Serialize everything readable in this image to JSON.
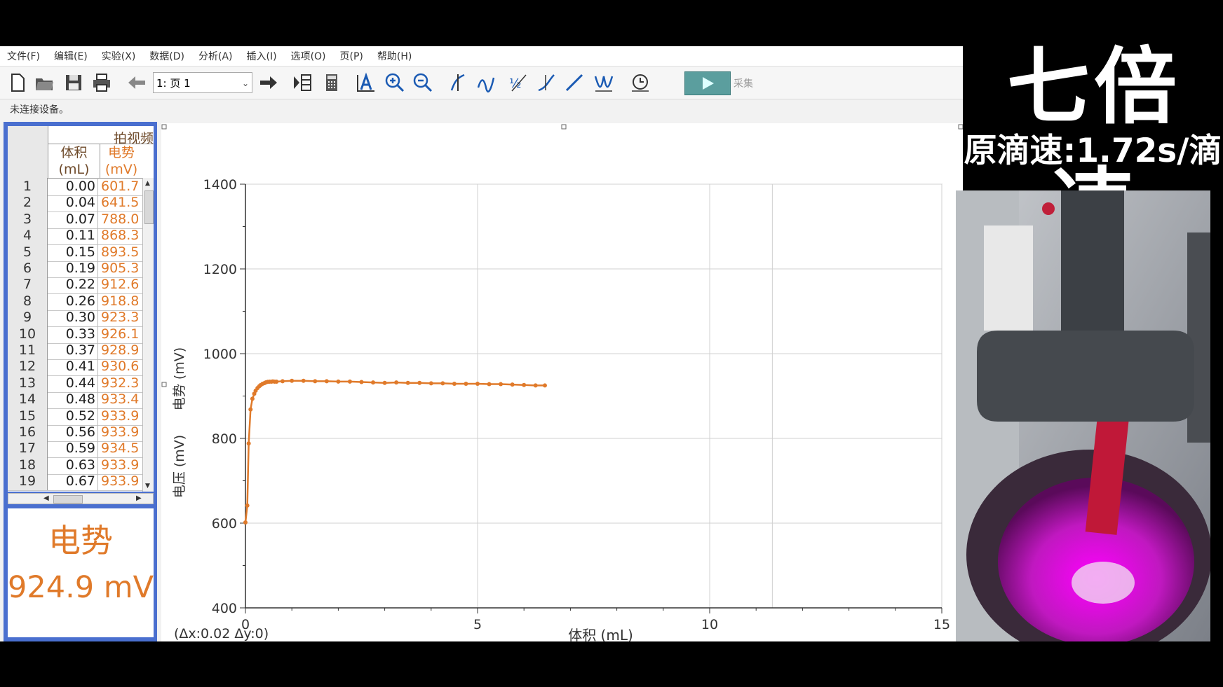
{
  "overlay": {
    "title": "七倍速",
    "subtitle": "原滴速:1.72s/滴"
  },
  "menubar": [
    "文件(F)",
    "编辑(E)",
    "实验(X)",
    "数据(D)",
    "分析(A)",
    "插入(I)",
    "选项(O)",
    "页(P)",
    "帮助(H)"
  ],
  "toolbar": {
    "page_select": "1: 页 1",
    "collect_label": "采集"
  },
  "status": "未连接设备。",
  "table": {
    "title": "拍视频",
    "col_volume": [
      "体积",
      "(mL)"
    ],
    "col_emf": [
      "电势",
      "(mV)"
    ],
    "rows": [
      [
        "1",
        "0.00",
        "601.7"
      ],
      [
        "2",
        "0.04",
        "641.5"
      ],
      [
        "3",
        "0.07",
        "788.0"
      ],
      [
        "4",
        "0.11",
        "868.3"
      ],
      [
        "5",
        "0.15",
        "893.5"
      ],
      [
        "6",
        "0.19",
        "905.3"
      ],
      [
        "7",
        "0.22",
        "912.6"
      ],
      [
        "8",
        "0.26",
        "918.8"
      ],
      [
        "9",
        "0.30",
        "923.3"
      ],
      [
        "10",
        "0.33",
        "926.1"
      ],
      [
        "11",
        "0.37",
        "928.9"
      ],
      [
        "12",
        "0.41",
        "930.6"
      ],
      [
        "13",
        "0.44",
        "932.3"
      ],
      [
        "14",
        "0.48",
        "933.4"
      ],
      [
        "15",
        "0.52",
        "933.9"
      ],
      [
        "16",
        "0.56",
        "933.9"
      ],
      [
        "17",
        "0.59",
        "934.5"
      ],
      [
        "18",
        "0.63",
        "933.9"
      ],
      [
        "19",
        "0.67",
        "933.9"
      ]
    ]
  },
  "meter": {
    "label": "电势",
    "value": "924.9 mV"
  },
  "graph": {
    "delta_readout": "(Δx:0.02 Δy:0)",
    "xlabel": "体积 (mL)",
    "ylabel_primary": "电势 (mV)",
    "ylabel_secondary": "电压 (mV)"
  },
  "colors": {
    "series": "#e07a2a",
    "table_panel": "#4a6fcf",
    "collect_button": "#5b9e9e"
  },
  "chart_data": {
    "type": "scatter",
    "xlabel": "体积 (mL)",
    "ylabel": "电势 (mV)",
    "xlim": [
      0,
      15
    ],
    "ylim": [
      400,
      1400
    ],
    "xticks": [
      0,
      5,
      10,
      15
    ],
    "yticks": [
      400,
      600,
      800,
      1000,
      1200,
      1400
    ],
    "grid": true,
    "series": [
      {
        "name": "电势",
        "x": [
          0.0,
          0.04,
          0.07,
          0.11,
          0.15,
          0.19,
          0.22,
          0.26,
          0.3,
          0.33,
          0.37,
          0.41,
          0.44,
          0.48,
          0.52,
          0.56,
          0.59,
          0.63,
          0.67,
          0.8,
          1.0,
          1.25,
          1.5,
          1.75,
          2.0,
          2.25,
          2.5,
          2.75,
          3.0,
          3.25,
          3.5,
          3.75,
          4.0,
          4.25,
          4.5,
          4.75,
          5.0,
          5.25,
          5.5,
          5.75,
          6.0,
          6.25,
          6.45
        ],
        "y": [
          601.7,
          641.5,
          788.0,
          868.3,
          893.5,
          905.3,
          912.6,
          918.8,
          923.3,
          926.1,
          928.9,
          930.6,
          932.3,
          933.4,
          933.9,
          933.9,
          934.5,
          933.9,
          933.9,
          935,
          936,
          936,
          935,
          935,
          934,
          934,
          933,
          932,
          931,
          932,
          931,
          931,
          930,
          930,
          929,
          929,
          929,
          928,
          928,
          927,
          926,
          925,
          924.9
        ]
      }
    ]
  }
}
